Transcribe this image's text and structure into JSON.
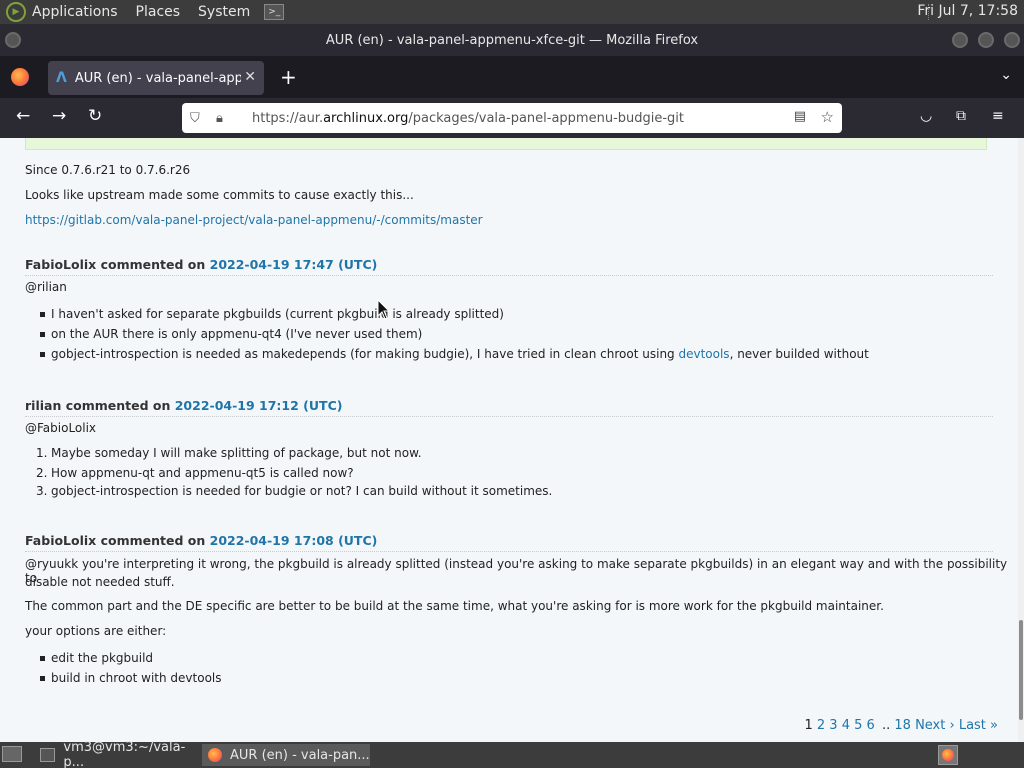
{
  "top_panel": {
    "menus": [
      "Applications",
      "Places",
      "System"
    ],
    "clock": "Fri Jul 7, 17:58"
  },
  "window": {
    "title": "AUR (en) - vala-panel-appmenu-xfce-git — Mozilla Firefox"
  },
  "tabs": [
    {
      "label": "AUR (en) - vala-panel-appmenu-xfce-git"
    }
  ],
  "navbar": {
    "url_prefix": "https://aur.",
    "url_domain": "archlinux.org",
    "url_path": "/packages/vala-panel-appmenu-budgie-git"
  },
  "content": {
    "intro": {
      "line1": "Since 0.7.6.r21 to 0.7.6.r26",
      "line2": "Looks like upstream made some commits to cause exactly this...",
      "link": "https://gitlab.com/vala-panel-project/vala-panel-appmenu/-/commits/master"
    },
    "comments": [
      {
        "author": "FabioLolix",
        "verb": " commented on ",
        "date": "2022-04-19 17:47 (UTC)",
        "mention": "@rilian",
        "bullets": [
          "I haven't asked for separate pkgbuilds (current pkgbuild is already splitted)",
          "on the AUR there is only appmenu-qt4 (I've never used them)"
        ],
        "bullet3_pre": "gobject-introspection is needed as makedepends (for making budgie), I have tried in clean chroot using ",
        "bullet3_link": "devtools",
        "bullet3_post": ", never builded without"
      },
      {
        "author": "rilian",
        "verb": " commented on ",
        "date": "2022-04-19 17:12 (UTC)",
        "mention": "@FabioLolix",
        "items": [
          "Maybe someday I will make splitting of package, but not now.",
          "How appmenu-qt and appmenu-qt5 is called now?",
          "gobject-introspection is needed for budgie or not? I can build without it sometimes."
        ]
      },
      {
        "author": "FabioLolix",
        "verb": " commented on ",
        "date": "2022-04-19 17:08 (UTC)",
        "para1_line1": "@ryuukk you're interpreting it wrong, the pkgbuild is already splitted (instead you're asking to make separate pkgbuilds) in an elegant way and with the possibility to",
        "para1_line2": "disable not needed stuff.",
        "para2": "The common part and the DE specific are better to be build at the same time, what you're asking for is more work for the pkgbuild maintainer.",
        "para3": "your options are either:",
        "bullets": [
          "edit the pkgbuild",
          "build in chroot with devtools"
        ]
      }
    ],
    "pager": {
      "current": "1",
      "pages": [
        "2",
        "3",
        "4",
        "5",
        "6"
      ],
      "ellipsis": "..",
      "last_page": "18",
      "next": "Next ›",
      "last": "Last »"
    }
  },
  "taskbar": {
    "tasks": [
      "vm3@vm3:~/vala-p...",
      "AUR (en) - vala-pan..."
    ]
  }
}
